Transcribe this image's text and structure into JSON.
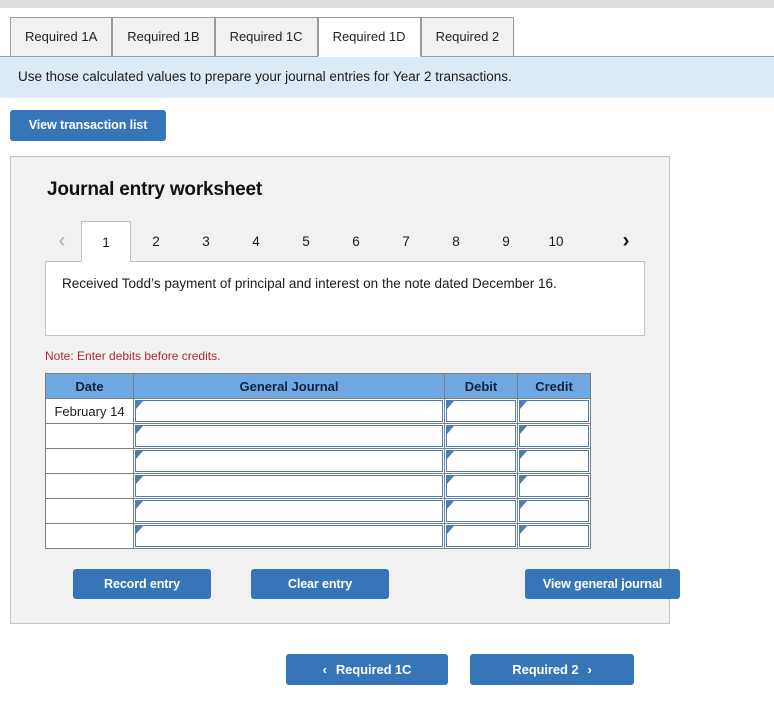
{
  "requirement_tabs": [
    {
      "label": "Required 1A",
      "active": false
    },
    {
      "label": "Required 1B",
      "active": false
    },
    {
      "label": "Required 1C",
      "active": false
    },
    {
      "label": "Required 1D",
      "active": true
    },
    {
      "label": "Required 2",
      "active": false
    }
  ],
  "banner": {
    "text": "Use those calculated values to prepare your journal entries for Year 2 transactions."
  },
  "view_transaction_list_label": "View transaction list",
  "worksheet": {
    "title": "Journal entry worksheet",
    "pager": {
      "prev_icon": "chevron-left-icon",
      "next_icon": "chevron-right-icon",
      "prev_glyph": "‹",
      "next_glyph": "›",
      "pages": [
        "1",
        "2",
        "3",
        "4",
        "5",
        "6",
        "7",
        "8",
        "9",
        "10"
      ],
      "active_page": "1"
    },
    "description": "Received Todd’s payment of principal and interest on the note dated December 16.",
    "note": "Note: Enter debits before credits.",
    "table": {
      "columns": [
        "Date",
        "General Journal",
        "Debit",
        "Credit"
      ],
      "rows": [
        {
          "date": "February 14",
          "general_journal": "",
          "debit": "",
          "credit": ""
        },
        {
          "date": "",
          "general_journal": "",
          "debit": "",
          "credit": ""
        },
        {
          "date": "",
          "general_journal": "",
          "debit": "",
          "credit": ""
        },
        {
          "date": "",
          "general_journal": "",
          "debit": "",
          "credit": ""
        },
        {
          "date": "",
          "general_journal": "",
          "debit": "",
          "credit": ""
        },
        {
          "date": "",
          "general_journal": "",
          "debit": "",
          "credit": ""
        }
      ]
    },
    "actions": {
      "record_entry": "Record entry",
      "clear_entry": "Clear entry",
      "view_general_journal": "View general journal"
    }
  },
  "bottom_nav": {
    "prev_label": "Required 1C",
    "next_label": "Required 2",
    "prev_icon": "chevron-left-icon",
    "next_icon": "chevron-right-icon",
    "prev_glyph": "‹",
    "next_glyph": "›"
  },
  "colors": {
    "button_blue": "#3575b8",
    "table_header_blue": "#6fa8e0",
    "banner_blue": "#dceaf6",
    "panel_gray": "#f1f1f1",
    "note_red": "#b02a37"
  }
}
